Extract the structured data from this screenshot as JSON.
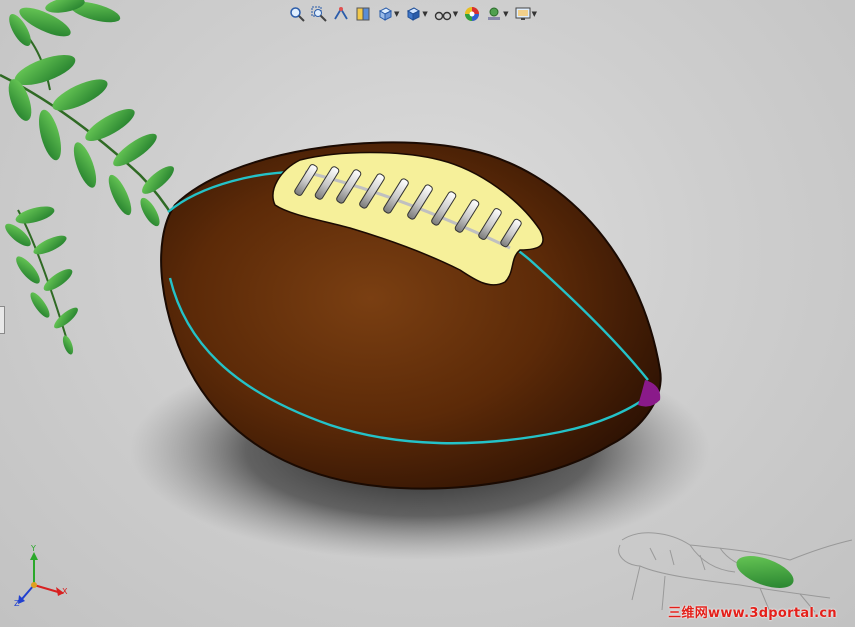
{
  "toolbar": {
    "items": [
      {
        "name": "zoom-to-fit",
        "has_dropdown": false
      },
      {
        "name": "zoom-to-area",
        "has_dropdown": false
      },
      {
        "name": "previous-view",
        "has_dropdown": false
      },
      {
        "name": "section-view",
        "has_dropdown": false
      },
      {
        "name": "view-orientation",
        "has_dropdown": true
      },
      {
        "name": "display-style",
        "has_dropdown": true
      },
      {
        "name": "hide-show-items",
        "has_dropdown": true
      },
      {
        "name": "edit-appearance",
        "has_dropdown": false
      },
      {
        "name": "apply-scene",
        "has_dropdown": true
      },
      {
        "name": "view-settings",
        "has_dropdown": true
      }
    ]
  },
  "triad": {
    "x": "X",
    "y": "Y",
    "z": "Z"
  },
  "colors": {
    "ball": "#6b3310",
    "seam": "#24c2c8",
    "lace_panel": "#f6f09a",
    "laces": "#d8d8d8",
    "tip": "#8a1a8a",
    "watermark": "#e3201a"
  },
  "watermark": {
    "text": "三维网www.3dportal.cn"
  }
}
